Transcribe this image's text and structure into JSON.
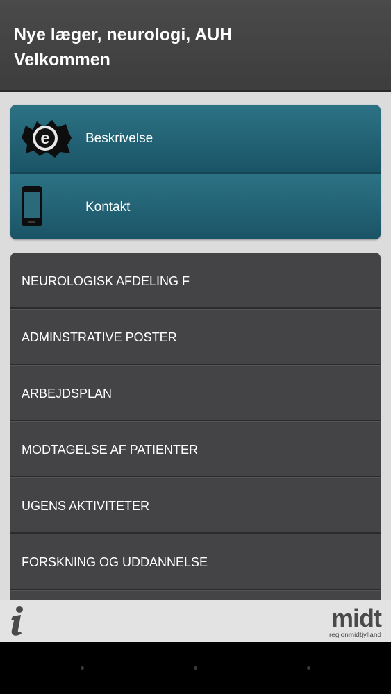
{
  "header": {
    "title": "Nye læger, neurologi, AUH",
    "subtitle": "Velkommen"
  },
  "quick_links": [
    {
      "label": "Beskrivelse",
      "icon": "e-logo-icon"
    },
    {
      "label": "Kontakt",
      "icon": "phone-icon"
    }
  ],
  "menu": [
    {
      "label": "NEUROLOGISK AFDELING F"
    },
    {
      "label": "ADMINSTRATIVE POSTER"
    },
    {
      "label": "ARBEJDSPLAN"
    },
    {
      "label": "MODTAGELSE AF PATIENTER"
    },
    {
      "label": "UGENS AKTIVITETER"
    },
    {
      "label": "FORSKNING OG UDDANNELSE"
    }
  ],
  "footer": {
    "info_icon": "info-icon",
    "logo_word": "midt",
    "logo_sub": "regionmidtjylland"
  },
  "colors": {
    "header_bg": "#444444",
    "teal": "#1f6173",
    "list_bg": "#444446",
    "page_bg": "#dcdcdc"
  }
}
